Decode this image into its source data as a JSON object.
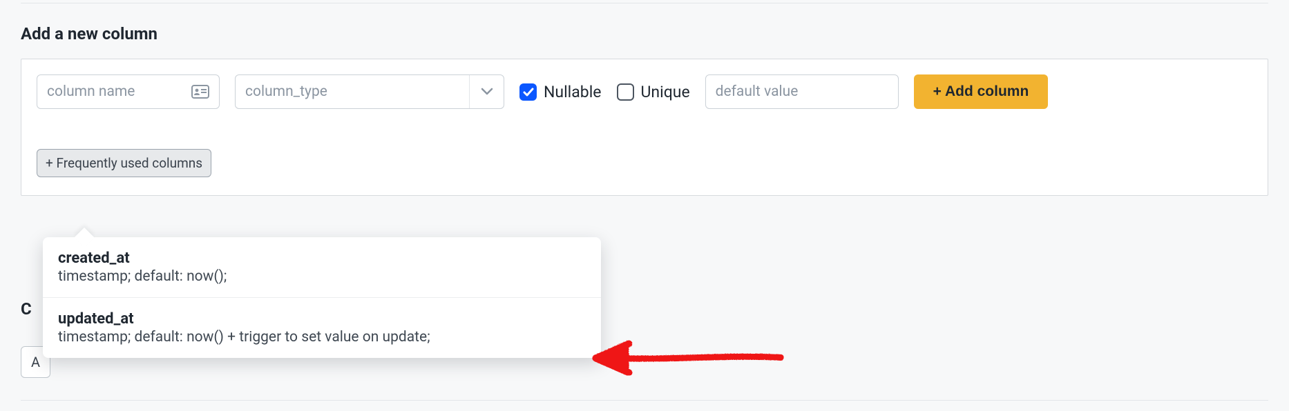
{
  "section": {
    "title": "Add a new column"
  },
  "fields": {
    "column_name_placeholder": "column name",
    "column_type_placeholder": "column_type",
    "default_value_placeholder": "default value"
  },
  "options": {
    "nullable_label": "Nullable",
    "unique_label": "Unique"
  },
  "buttons": {
    "add_column": "+ Add column",
    "freq_used": "+ Frequently used columns"
  },
  "popover": {
    "items": [
      {
        "name": "created_at",
        "desc": "timestamp; default: now();"
      },
      {
        "name": "updated_at",
        "desc": "timestamp; default: now() + trigger to set value on update;"
      }
    ]
  },
  "behind": {
    "title_fragment": "C",
    "button_fragment": "A"
  }
}
